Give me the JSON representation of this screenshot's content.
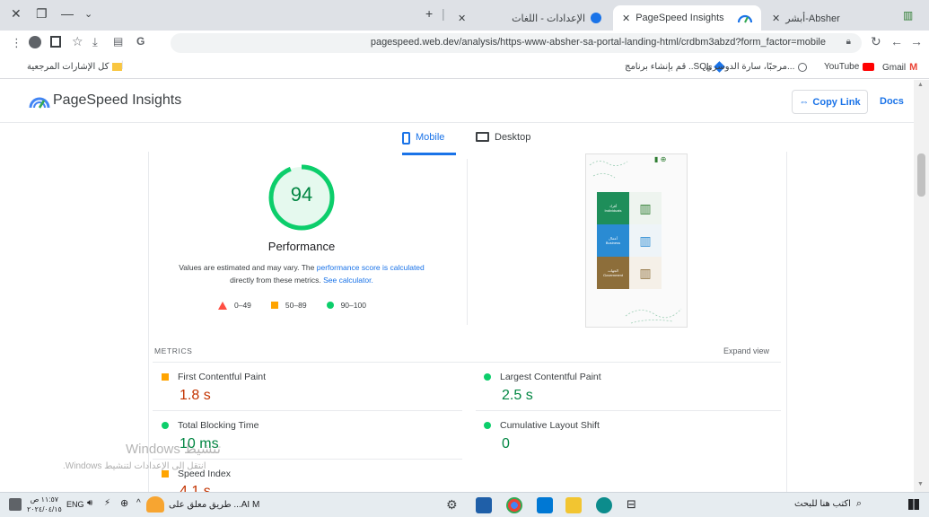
{
  "browser": {
    "tabs": [
      {
        "title": "أبشر-Absher",
        "active": false
      },
      {
        "title": "PageSpeed Insights",
        "active": true
      },
      {
        "title": "الإعدادات - اللغات",
        "active": false
      }
    ],
    "url": "pagespeed.web.dev/analysis/https-www-absher-sa-portal-landing-html/crdbm3abzd?form_factor=mobile",
    "bookmarks": [
      {
        "label": "Gmail"
      },
      {
        "label": "YouTube"
      },
      {
        "label": "مرحبًا، سارة الدوسري..."
      },
      {
        "label": "قم بإنشاء برنامج ..SQL"
      }
    ],
    "all_bookmarks_label": "كل الإشارات المرجعية"
  },
  "header": {
    "title": "PageSpeed Insights",
    "copy_link": "Copy Link",
    "docs": "Docs"
  },
  "tabs": {
    "mobile": "Mobile",
    "desktop": "Desktop"
  },
  "score": {
    "value": "94",
    "label": "Performance",
    "note_prefix": "Values are estimated and may vary. The ",
    "note_link1": "performance score is calculated",
    "note_mid": " directly from these metrics. ",
    "note_link2": "See calculator.",
    "legend": [
      "0–49",
      "50–89",
      "90–100"
    ]
  },
  "metrics": {
    "heading": "METRICS",
    "expand": "Expand view",
    "items": [
      {
        "name": "First Contentful Paint",
        "value": "1.8 s",
        "status": "average"
      },
      {
        "name": "Largest Contentful Paint",
        "value": "2.5 s",
        "status": "good"
      },
      {
        "name": "Total Blocking Time",
        "value": "10 ms",
        "status": "good"
      },
      {
        "name": "Cumulative Layout Shift",
        "value": "0",
        "status": "good"
      },
      {
        "name": "Speed Index",
        "value": "4.1 s",
        "status": "average"
      }
    ]
  },
  "preview": {
    "cards": [
      {
        "line1": "أفراد",
        "line2": "Individuals"
      },
      {
        "line1": "أعمال",
        "line2": "Business"
      },
      {
        "line1": "الجهات",
        "line2": "Government"
      }
    ]
  },
  "watermark": {
    "line1": "Windows تنشيط",
    "line2": "انتقل إلى الإعدادات لتنشيط Windows."
  },
  "taskbar": {
    "search_placeholder": "اكتب هنا للبحث",
    "news": "AI M... طريق معلق على",
    "lang": "ENG",
    "time": "١١:٥٧ ص",
    "date": "٢٠٢٤/٠٤/١٥"
  },
  "colors": {
    "good": "#0cce6b",
    "good_text": "#018642",
    "average": "#ffa400",
    "average_text": "#c33300",
    "poor": "#ff4e42",
    "link": "#1a73e8"
  }
}
